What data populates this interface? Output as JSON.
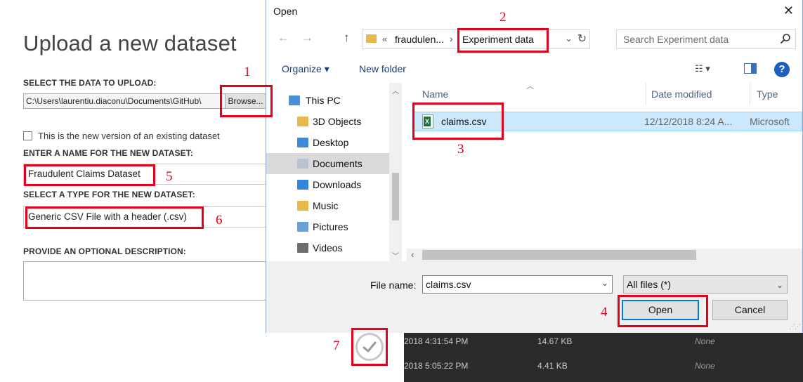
{
  "bg": {
    "page_title": "Upload a new dataset",
    "select_label": "SELECT THE DATA TO UPLOAD:",
    "file_path": "C:\\Users\\laurentiu.diaconu\\Documents\\GitHub\\",
    "browse_label": "Browse...",
    "version_text": "This is the new version of an existing dataset",
    "name_label": "ENTER A NAME FOR THE NEW DATASET:",
    "name_value": "Fraudulent Claims Dataset",
    "type_label": "SELECT A TYPE FOR THE NEW DATASET:",
    "type_value": "Generic CSV File with a header (.csv)",
    "desc_label": "PROVIDE AN OPTIONAL DESCRIPTION:",
    "rows": [
      {
        "date": "2018 4:31:54 PM",
        "size": "14.67 KB",
        "desc": "None"
      },
      {
        "date": "2018 5:05:22 PM",
        "size": "4.41 KB",
        "desc": "None"
      }
    ]
  },
  "dialog": {
    "title": "Open",
    "close": "✕",
    "nav": {
      "back": "←",
      "forward": "→",
      "up": "↑"
    },
    "address": {
      "chevron": "«",
      "crumb1": "fraudulen...",
      "sep": "›",
      "crumb2": "Experiment data",
      "dropdown": "⌄",
      "refresh": "↻"
    },
    "search_placeholder": "Search Experiment data",
    "toolbar": {
      "organize": "Organize ▾",
      "new_folder": "New folder",
      "view": "☷ ▾",
      "help": "?"
    },
    "nav_items": [
      {
        "label": "This PC",
        "icon": "computer-icon",
        "color": "#4a90d9"
      },
      {
        "label": "3D Objects",
        "icon": "cube-folder-icon",
        "color": "#e8b84a"
      },
      {
        "label": "Desktop",
        "icon": "desktop-folder-icon",
        "color": "#3f8ad8"
      },
      {
        "label": "Documents",
        "icon": "documents-folder-icon",
        "color": "#b7c3d1"
      },
      {
        "label": "Downloads",
        "icon": "downloads-folder-icon",
        "color": "#2f86dc"
      },
      {
        "label": "Music",
        "icon": "music-folder-icon",
        "color": "#e8b84a"
      },
      {
        "label": "Pictures",
        "icon": "pictures-folder-icon",
        "color": "#6aa2d8"
      },
      {
        "label": "Videos",
        "icon": "videos-folder-icon",
        "color": "#6d6d6d"
      }
    ],
    "columns": {
      "name": "Name",
      "date": "Date modified",
      "type": "Type"
    },
    "file": {
      "name": "claims.csv",
      "date": "12/12/2018 8:24 A...",
      "type": "Microsoft",
      "icon_letter": "X"
    },
    "filename_label": "File name:",
    "filename_value": "claims.csv",
    "filetype_value": "All files (*)",
    "open_label": "Open",
    "cancel_label": "Cancel"
  },
  "annotations": [
    "1",
    "2",
    "3",
    "4",
    "5",
    "6",
    "7"
  ],
  "colors": {
    "highlight": "#e3001b",
    "selection": "#cce8ff",
    "accent": "#0078d7"
  }
}
